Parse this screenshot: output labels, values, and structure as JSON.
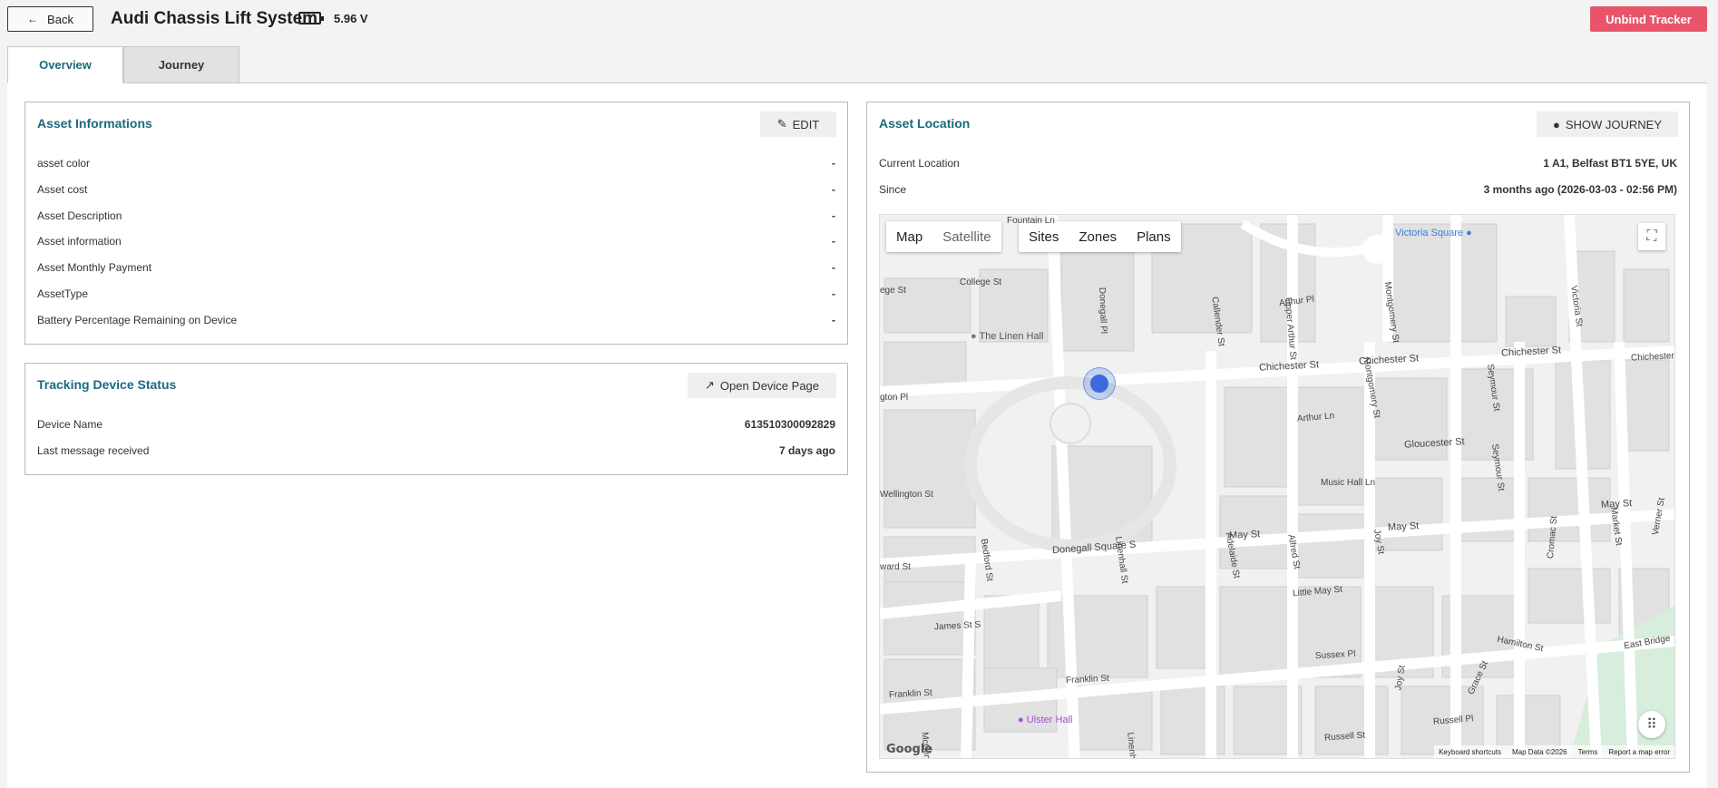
{
  "header": {
    "back_label": "Back",
    "title": "Audi Chassis Lift System",
    "battery_icon_text": "?",
    "voltage": "5.96 V",
    "unbind_label": "Unbind Tracker"
  },
  "tabs": [
    {
      "label": "Overview",
      "active": true
    },
    {
      "label": "Journey",
      "active": false
    }
  ],
  "asset_info": {
    "title": "Asset Informations",
    "edit_label": "EDIT",
    "rows": [
      {
        "label": "asset color",
        "value": "-"
      },
      {
        "label": "Asset cost",
        "value": "-"
      },
      {
        "label": "Asset Description",
        "value": "-"
      },
      {
        "label": "Asset information",
        "value": "-"
      },
      {
        "label": "Asset Monthly Payment",
        "value": "-"
      },
      {
        "label": "AssetType",
        "value": "-"
      },
      {
        "label": "Battery Percentage Remaining on Device",
        "value": "-"
      }
    ]
  },
  "device_status": {
    "title": "Tracking Device Status",
    "open_label": "Open Device Page",
    "rows": [
      {
        "label": "Device Name",
        "value": "613510300092829"
      },
      {
        "label": "Last message received",
        "value": "7 days ago"
      }
    ]
  },
  "location": {
    "title": "Asset Location",
    "show_journey_label": "SHOW JOURNEY",
    "current_location_label": "Current Location",
    "current_location_value": "1 A1, Belfast BT1 5YE, UK",
    "since_label": "Since",
    "since_value": "3 months ago  (2026-03-03 - 02:56 PM)"
  },
  "map": {
    "type_map": "Map",
    "type_satellite": "Satellite",
    "layers": [
      "Sites",
      "Zones",
      "Plans"
    ],
    "pois": [
      "Victoria Square",
      "The Linen Hall",
      "Ulster Hall"
    ],
    "streets": [
      "Fountain Ln",
      "College St",
      "Donegall Pl",
      "Callender St",
      "Upper Arthur St",
      "Arthur Pl",
      "Montgomery St",
      "Victoria St",
      "Chichester St",
      "Chichester St",
      "Chichester St",
      "Chichester St",
      "Arthur Ln",
      "Montgomery St",
      "Seymour St",
      "Gloucester St",
      "Music Hall Ln",
      "Seymour St",
      "Wellington St",
      "May St",
      "May St",
      "May St",
      "Donegall Square S",
      "Bedford St",
      "Linenhall St",
      "Adelaide St",
      "Alfred St",
      "Joy St",
      "Cromac St",
      "Market St",
      "Verner St",
      "Little May St",
      "James St S",
      "Sussex Pl",
      "Hamilton St",
      "Grace St",
      "East Bridge",
      "Franklin St",
      "Franklin St",
      "Joy St",
      "Russell Pl",
      "Russell St",
      "Linenh",
      "McClin",
      "ward St",
      "gton Pl",
      "ege St"
    ],
    "google": "Google",
    "attribution": [
      "Keyboard shortcuts",
      "Map Data ©2026",
      "Terms",
      "Report a map error"
    ]
  },
  "colors": {
    "accent": "#1a6a7e",
    "danger": "#e8556b",
    "marker": "#3d6adb"
  }
}
